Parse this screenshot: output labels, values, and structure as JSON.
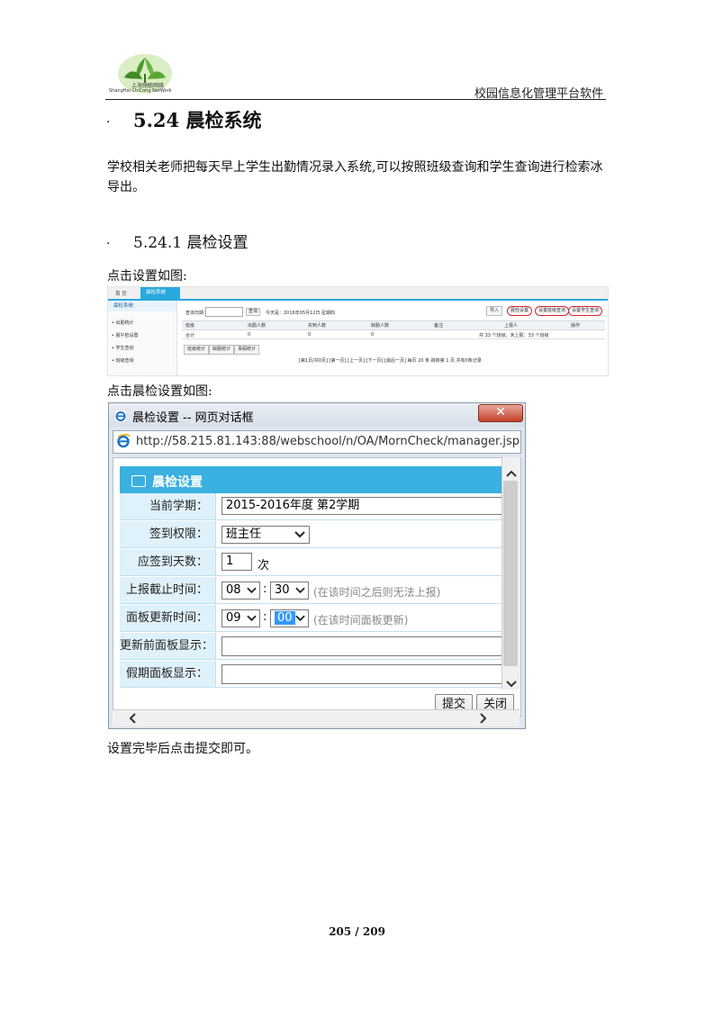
{
  "header": {
    "logo_cn": "上海驰聪网络",
    "logo_en": "ShangHai ChiCong NetWork",
    "right_title": "校园信息化管理平台软件"
  },
  "section": {
    "bullet": "·",
    "title": "5.24 晨检系统",
    "paragraph": "学校相关老师把每天早上学生出勤情况录入系统,可以按照班级查询和学生查询进行检索冰导出。",
    "sub_bullet": "·",
    "sub_title": "5.24.1 晨检设置",
    "caption1": "点击设置如图:",
    "caption2": "点击晨检设置如图:",
    "caption3": "设置完毕后点击提交即可。"
  },
  "shot1": {
    "tab_home": "首 页",
    "tab_active": "晨检系统",
    "side_title": "晨检系统",
    "side_items": [
      "• 出勤统计",
      "• 晨午检设置",
      "• 学生查询",
      "• 班级查询"
    ],
    "query_label": "查询日期：",
    "query_btn": "查询",
    "today_text": "今天是：2016年05月12日 星期四",
    "right_btns": [
      "导入",
      "晨检设置",
      "设置班级查询",
      "设置学生查询"
    ],
    "columns": [
      "班级",
      "出勤人数",
      "实到人数",
      "缺勤人数",
      "备注",
      "上报人",
      "操作"
    ],
    "row": [
      "合计",
      "0",
      "0",
      "0",
      "",
      "共 33 个班级，未上报：33 个班级",
      ""
    ],
    "sub_btns": [
      "班级统计",
      "缺勤统计",
      "事假统计"
    ],
    "pager": "[第1页/共0页] [第一页] [上一页] [下一页] [最后一页] 每页 20 条 跳转第 1 页 共有0条记录"
  },
  "dialog": {
    "title": "晨检设置 -- 网页对话框",
    "close": "✕",
    "url": "http://58.215.81.143:88/webschool/n/OA/MornCheck/manager.jsp",
    "panel_title": "晨检设置",
    "fields": {
      "term_label": "当前学期：",
      "term_value": "2015-2016年度 第2学期",
      "perm_label": "签到权限：",
      "perm_value": "班主任",
      "days_label": "应签到天数：",
      "days_value": "1",
      "days_unit": "次",
      "deadline_label": "上报截止时间：",
      "deadline_hour": "08",
      "deadline_min": "30",
      "deadline_hint": "(在该时间之后则无法上报)",
      "refresh_label": "面板更新时间：",
      "refresh_hour": "09",
      "refresh_min": "00",
      "refresh_hint": "(在该时间面板更新)",
      "before_label": "更新前面板显示：",
      "holiday_label": "假期面板显示："
    },
    "colon": ":",
    "submit": "提交",
    "close_btn": "关闭"
  },
  "footer": {
    "page": "205 / 209"
  }
}
